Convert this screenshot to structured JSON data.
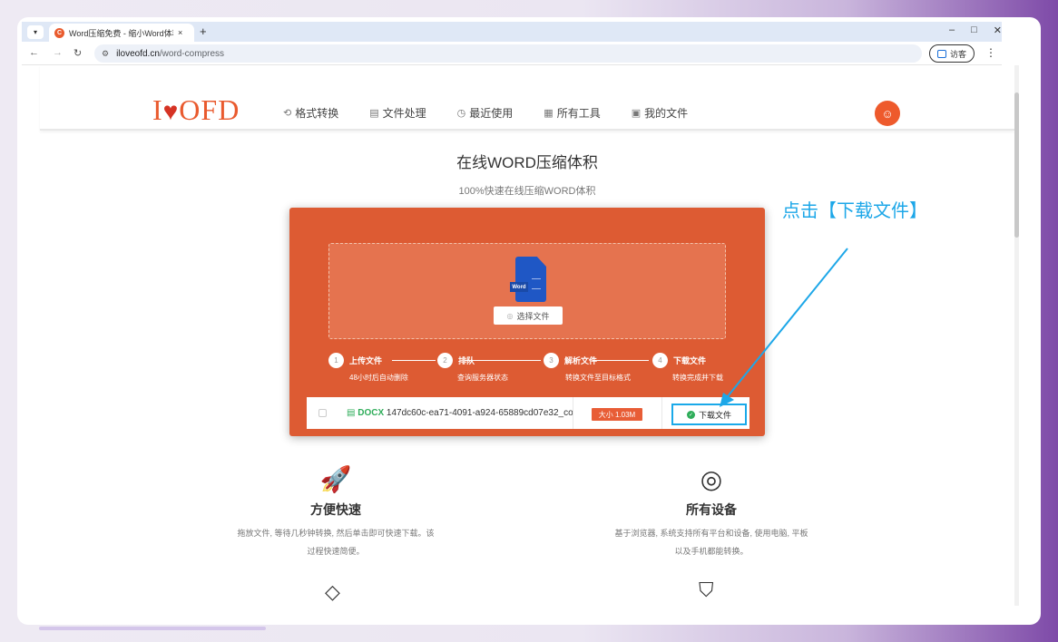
{
  "browser": {
    "tab_title": "Word压缩免费 - 缩小Word体积",
    "tab_close": "×",
    "new_tab": "+",
    "url_domain": "iloveofd.cn",
    "url_path": "/word-compress",
    "guest_label": "访客",
    "win_min": "–",
    "win_max": "□",
    "win_close": "✕"
  },
  "nav": {
    "logo_left": "I",
    "logo_heart": "♥",
    "logo_right": "OFD",
    "items": [
      {
        "label": "格式转换",
        "icon": "convert-icon"
      },
      {
        "label": "文件处理",
        "icon": "file-process-icon"
      },
      {
        "label": "最近使用",
        "icon": "recent-icon"
      },
      {
        "label": "所有工具",
        "icon": "tools-icon"
      },
      {
        "label": "我的文件",
        "icon": "my-files-icon"
      }
    ]
  },
  "page": {
    "title": "在线WORD压缩体积",
    "subtitle": "100%快速在线压缩WORD体积"
  },
  "upload": {
    "word_tag": "Word",
    "select_label": "选择文件",
    "steps": [
      {
        "num": "1",
        "label": "上传文件",
        "desc": "48小时后自动删除"
      },
      {
        "num": "2",
        "label": "排队",
        "desc": "查询服务器状态"
      },
      {
        "num": "3",
        "label": "解析文件",
        "desc": "转换文件至目标格式"
      },
      {
        "num": "4",
        "label": "下载文件",
        "desc": "转换完成并下载"
      }
    ]
  },
  "file": {
    "ext": "DOCX",
    "name": "147dc60c-ea71-4091-a924-65889cd07e32_co",
    "size": "大小 1.03M",
    "download_label": "下载文件"
  },
  "annotation": {
    "text": "点击【下载文件】",
    "color": "#1da7e8"
  },
  "features": [
    {
      "icon": "rocket-icon",
      "title": "方便快速",
      "desc": "拖放文件, 等待几秒钟转换, 然后单击即可快速下载。该过程快速简便。"
    },
    {
      "icon": "target-icon",
      "title": "所有设备",
      "desc": "基于浏览器, 系统支持所有平台和设备, 使用电脑, 平板以及手机都能转换。"
    }
  ],
  "colors": {
    "brand": "#e95a2e",
    "card": "#dd5b33",
    "success": "#2fad5a"
  }
}
